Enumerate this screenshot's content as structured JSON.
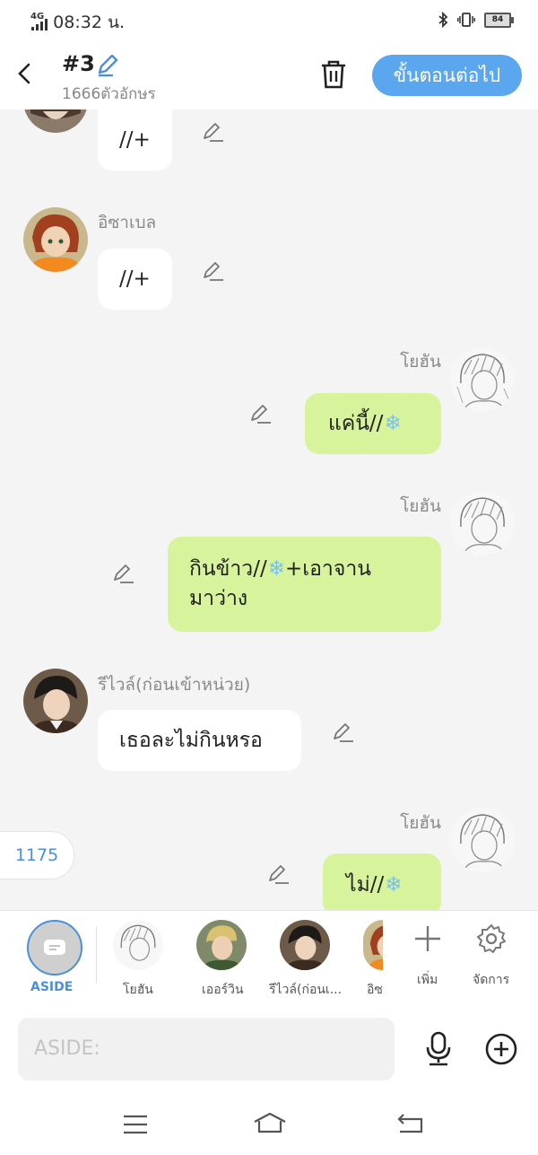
{
  "status_bar": {
    "network": "4G",
    "time": "08:32 น.",
    "battery": "84"
  },
  "header": {
    "title": "#3",
    "char_count": "1666ตัวอักษร",
    "next_label": "ขั้นตอนต่อไป"
  },
  "messages": [
    {
      "side": "left",
      "sender": "",
      "text": "//+",
      "avatar": "partial-character"
    },
    {
      "side": "left",
      "sender": "อิซาเบล",
      "text": "//+",
      "avatar": "isabel"
    },
    {
      "side": "right",
      "sender": "โยฮัน",
      "text": "แค่นี้//",
      "snow": true,
      "avatar": "johan"
    },
    {
      "side": "right",
      "sender": "โยฮัน",
      "text_line1": "กินข้าว//",
      "text_line1_tail": "+เอาจาน",
      "text_line2": "มาว่าง",
      "snow": true,
      "avatar": "johan"
    },
    {
      "side": "left",
      "sender": "รีไวล์(ก่อนเข้าหน่วย)",
      "text": "เธอละไม่กินหรอ",
      "avatar": "levi"
    },
    {
      "side": "right",
      "sender": "โยฮัน",
      "text": "ไม่//",
      "snow": true,
      "avatar": "johan"
    }
  ],
  "floating_count": "1175",
  "character_bar": {
    "aside_label": "ASIDE",
    "characters": [
      "โยฮัน",
      "เออร์วิน",
      "รีไวล์(ก่อนเ...",
      "อิซ"
    ],
    "add_label": "เพิ่ม",
    "manage_label": "จัดการ"
  },
  "input": {
    "placeholder": "ASIDE:"
  },
  "colors": {
    "accent": "#5aa7f0",
    "right_bubble": "#d7f39c",
    "left_bubble": "#ffffff"
  }
}
